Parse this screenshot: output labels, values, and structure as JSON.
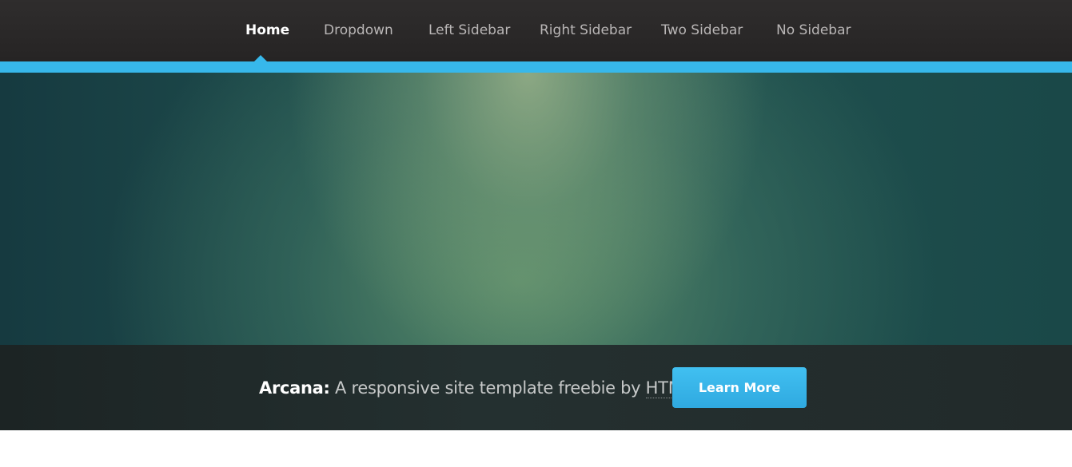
{
  "nav": {
    "items": [
      {
        "label": "Home",
        "active": true
      },
      {
        "label": "Dropdown",
        "active": false
      },
      {
        "label": "Left Sidebar",
        "active": false
      },
      {
        "label": "Right Sidebar",
        "active": false
      },
      {
        "label": "Two Sidebar",
        "active": false
      },
      {
        "label": "No Sidebar",
        "active": false
      }
    ]
  },
  "banner": {
    "brand": "Arcana:",
    "tagline": " A responsive site template freebie by ",
    "link_text": "HTML5 UP",
    "cta_label": "Learn More"
  },
  "colors": {
    "accent": "#37b8eb",
    "nav_bg": "#2b2929",
    "banner_bg": "#222a2a"
  }
}
